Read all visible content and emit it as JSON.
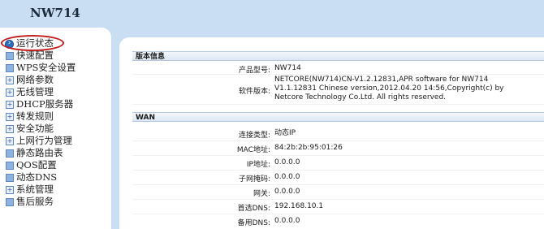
{
  "brand": {
    "title": "NW714"
  },
  "sidebar": {
    "items": [
      {
        "label": "运行状态",
        "icon": "arrow-circle-icon",
        "serif": false
      },
      {
        "label": "快速配置",
        "icon": "page-icon",
        "serif": false
      },
      {
        "label": "WPS安全设置",
        "icon": "page-icon",
        "serif": true
      },
      {
        "label": "网络参数",
        "icon": "plus-box-icon",
        "serif": false
      },
      {
        "label": "无线管理",
        "icon": "plus-box-icon",
        "serif": false
      },
      {
        "label": "DHCP服务器",
        "icon": "plus-box-icon",
        "serif": true
      },
      {
        "label": "转发规则",
        "icon": "plus-box-icon",
        "serif": false
      },
      {
        "label": "安全功能",
        "icon": "plus-box-icon",
        "serif": false
      },
      {
        "label": "上网行为管理",
        "icon": "plus-box-icon",
        "serif": false
      },
      {
        "label": "静态路由表",
        "icon": "page-icon",
        "serif": false
      },
      {
        "label": "QOS配置",
        "icon": "page-icon",
        "serif": true
      },
      {
        "label": "动态DNS",
        "icon": "page-icon",
        "serif": true
      },
      {
        "label": "系统管理",
        "icon": "plus-box-icon",
        "serif": false
      },
      {
        "label": "售后服务",
        "icon": "page-icon",
        "serif": false
      }
    ]
  },
  "version_section": {
    "title": "版本信息",
    "rows": [
      {
        "label": "产品型号:",
        "value": "NW714"
      },
      {
        "label": "软件版本:",
        "value_lines": [
          "NETCORE(NW714)CN-V1.2.12831,APR software for NW714",
          "V1.1.12831 Chinese version,2012.04.20 14:56,Copyright(c) by",
          "Netcore Technology Co.Ltd. All rights reserved."
        ]
      }
    ]
  },
  "wan_section": {
    "title": "WAN",
    "rows": [
      {
        "label": "连接类型:",
        "value": "动态IP"
      },
      {
        "label": "MAC地址:",
        "value": "84:2b:2b:95:01:26"
      },
      {
        "label": "IP地址:",
        "value": "0.0.0.0"
      },
      {
        "label": "子网掩码:",
        "value": "0.0.0.0"
      },
      {
        "label": "网关:",
        "value": "0.0.0.0"
      },
      {
        "label": "首选DNS:",
        "value": "192.168.10.1"
      },
      {
        "label": "备用DNS:",
        "value": "0.0.0.0"
      }
    ]
  },
  "colors": {
    "background": "#c9def3",
    "active_ring": "#c21d1d",
    "header_border": "#b7c8dd"
  }
}
